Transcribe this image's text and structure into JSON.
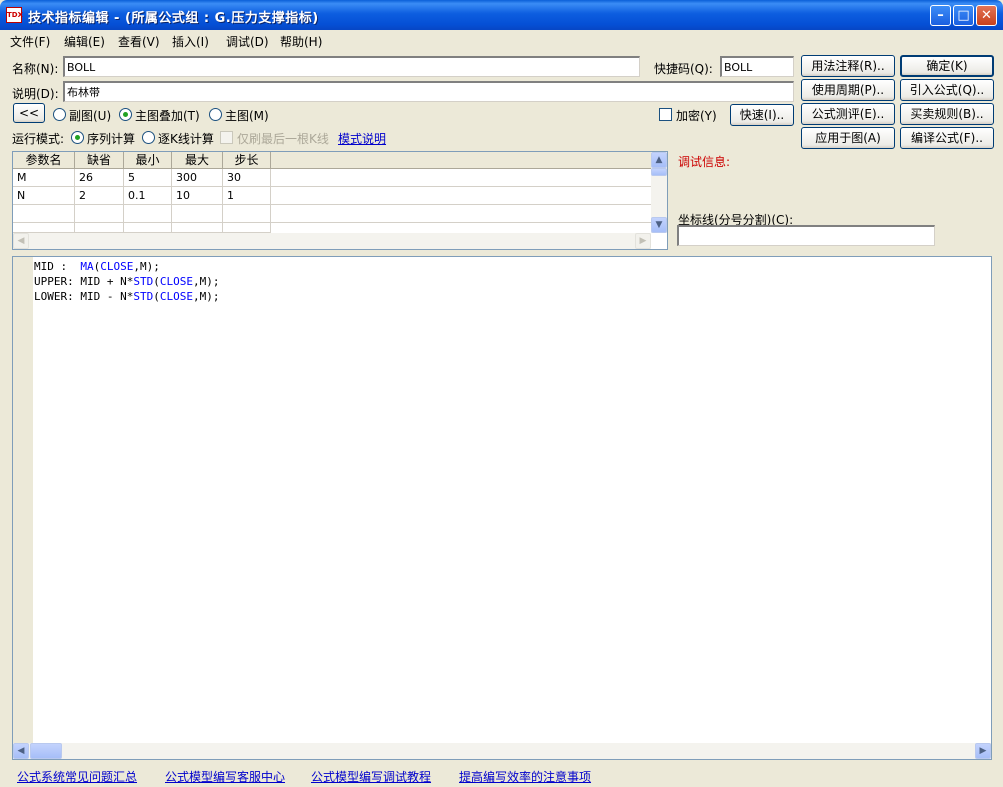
{
  "window": {
    "app_icon": "TDX",
    "title": "技术指标编辑 - (所属公式组 : G.压力支撑指标)",
    "buttons": [
      "minimize-icon",
      "maximize-icon",
      "close-icon"
    ]
  },
  "menu": [
    "文件(F)",
    "编辑(E)",
    "查看(V)",
    "插入(I)",
    "调试(D)",
    "帮助(H)"
  ],
  "form": {
    "name_label": "名称(N):",
    "name_value": "BOLL",
    "hotkey_label": "快捷码(Q):",
    "hotkey_value": "BOLL",
    "desc_label": "说明(D):",
    "desc_value": "布林带",
    "collapse_btn": "<<",
    "radio_sub": "副图(U)",
    "radio_main_overlay": "主图叠加(T)",
    "radio_main": "主图(M)",
    "encrypt_label": "加密(Y)",
    "quick_btn": "快速(I)..",
    "run_mode_label": "运行模式:",
    "mode_seq": "序列计算",
    "mode_bar": "逐K线计算",
    "mode_last": "仅刷最后一根K线",
    "mode_help": "模式说明"
  },
  "right_buttons": {
    "usage_note": "用法注释(R)..",
    "ok": "确定(K)",
    "period": "使用周期(P)..",
    "import": "引入公式(Q)..",
    "test": "公式测评(E)..",
    "trade_rules": "买卖规则(B)..",
    "apply": "应用于图(A)",
    "compile": "编译公式(F).."
  },
  "params": {
    "headers": [
      "参数名",
      "缺省",
      "最小",
      "最大",
      "步长"
    ],
    "rows": [
      [
        "M",
        "26",
        "5",
        "300",
        "30"
      ],
      [
        "N",
        "2",
        "0.1",
        "10",
        "1"
      ]
    ]
  },
  "debug": {
    "label": "调试信息:",
    "axis_label": "坐标线(分号分割)(C):",
    "axis_value": ""
  },
  "code": [
    [
      {
        "t": "MID :  ",
        "k": false
      },
      {
        "t": "MA",
        "k": true
      },
      {
        "t": "(",
        "k": false
      },
      {
        "t": "CLOSE",
        "k": true
      },
      {
        "t": ",M);",
        "k": false
      }
    ],
    [
      {
        "t": "UPPER: MID + N*",
        "k": false
      },
      {
        "t": "STD",
        "k": true
      },
      {
        "t": "(",
        "k": false
      },
      {
        "t": "CLOSE",
        "k": true
      },
      {
        "t": ",M);",
        "k": false
      }
    ],
    [
      {
        "t": "LOWER: MID - N*",
        "k": false
      },
      {
        "t": "STD",
        "k": true
      },
      {
        "t": "(",
        "k": false
      },
      {
        "t": "CLOSE",
        "k": true
      },
      {
        "t": ",M);",
        "k": false
      }
    ]
  ],
  "footer_links": [
    "公式系统常见问题汇总",
    "公式模型编写客服中心",
    "公式模型编写调试教程",
    "提高编写效率的注意事项"
  ],
  "colors": {
    "debug_label": "#cc0000",
    "keyword": "#0000ff",
    "link": "#0000cc"
  }
}
